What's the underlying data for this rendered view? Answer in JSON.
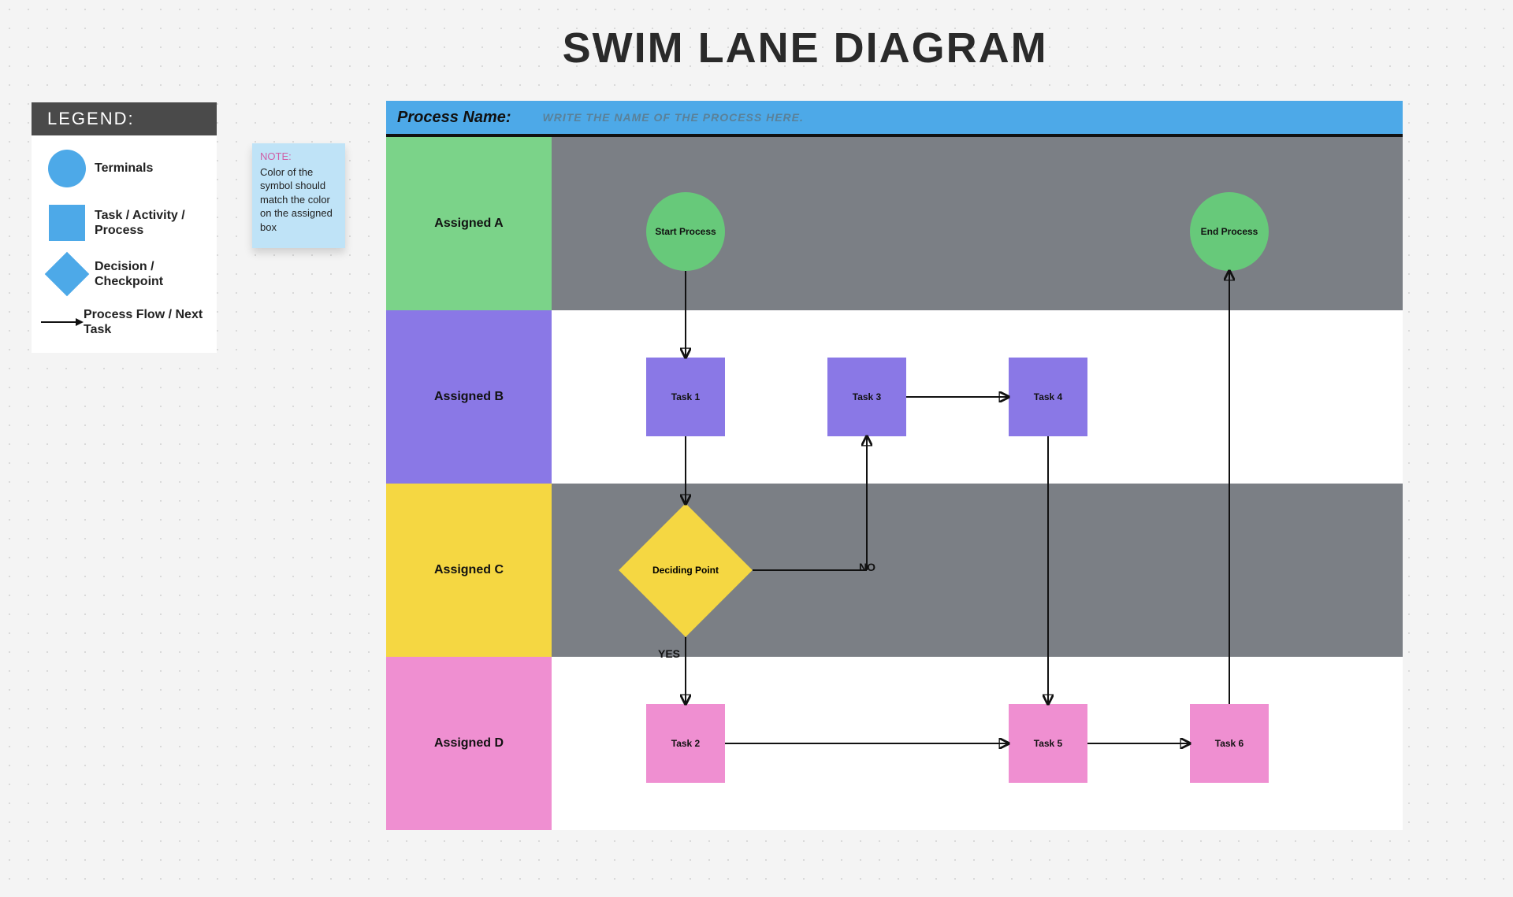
{
  "title": "SWIM LANE DIAGRAM",
  "legend": {
    "header": "LEGEND:",
    "terminals": "Terminals",
    "task": "Task / Activity / Process",
    "decision": "Decision / Checkpoint",
    "flow": "Process Flow / Next Task"
  },
  "note": {
    "title": "NOTE:",
    "body": "Color of the symbol should match the color on the assigned box"
  },
  "process": {
    "label": "Process Name:",
    "placeholder": "WRITE THE NAME OF THE PROCESS HERE."
  },
  "lanes": {
    "a": "Assigned A",
    "b": "Assigned B",
    "c": "Assigned C",
    "d": "Assigned D"
  },
  "nodes": {
    "start": "Start Process",
    "end": "End Process",
    "task1": "Task 1",
    "task2": "Task 2",
    "task3": "Task 3",
    "task4": "Task 4",
    "task5": "Task 5",
    "task6": "Task 6",
    "decide": "Deciding Point"
  },
  "labels": {
    "yes": "YES",
    "no": "NO"
  },
  "chart_data": {
    "type": "swimlane",
    "title": "SWIM LANE DIAGRAM",
    "lanes": [
      {
        "id": "A",
        "label": "Assigned A",
        "color": "#7bd389"
      },
      {
        "id": "B",
        "label": "Assigned B",
        "color": "#8a78e6"
      },
      {
        "id": "C",
        "label": "Assigned C",
        "color": "#f5d742"
      },
      {
        "id": "D",
        "label": "Assigned D",
        "color": "#ef8fd1"
      }
    ],
    "nodes": [
      {
        "id": "start",
        "type": "terminal",
        "lane": "A",
        "label": "Start Process"
      },
      {
        "id": "task1",
        "type": "task",
        "lane": "B",
        "label": "Task 1"
      },
      {
        "id": "decide",
        "type": "decision",
        "lane": "C",
        "label": "Deciding Point"
      },
      {
        "id": "task2",
        "type": "task",
        "lane": "D",
        "label": "Task 2"
      },
      {
        "id": "task3",
        "type": "task",
        "lane": "B",
        "label": "Task 3"
      },
      {
        "id": "task4",
        "type": "task",
        "lane": "B",
        "label": "Task 4"
      },
      {
        "id": "task5",
        "type": "task",
        "lane": "D",
        "label": "Task 5"
      },
      {
        "id": "task6",
        "type": "task",
        "lane": "D",
        "label": "Task 6"
      },
      {
        "id": "end",
        "type": "terminal",
        "lane": "A",
        "label": "End Process"
      }
    ],
    "edges": [
      {
        "from": "start",
        "to": "task1"
      },
      {
        "from": "task1",
        "to": "decide"
      },
      {
        "from": "decide",
        "to": "task2",
        "label": "YES"
      },
      {
        "from": "decide",
        "to": "task3",
        "label": "NO"
      },
      {
        "from": "task3",
        "to": "task4"
      },
      {
        "from": "task4",
        "to": "task5"
      },
      {
        "from": "task2",
        "to": "task5"
      },
      {
        "from": "task5",
        "to": "task6"
      },
      {
        "from": "task6",
        "to": "end"
      }
    ]
  }
}
